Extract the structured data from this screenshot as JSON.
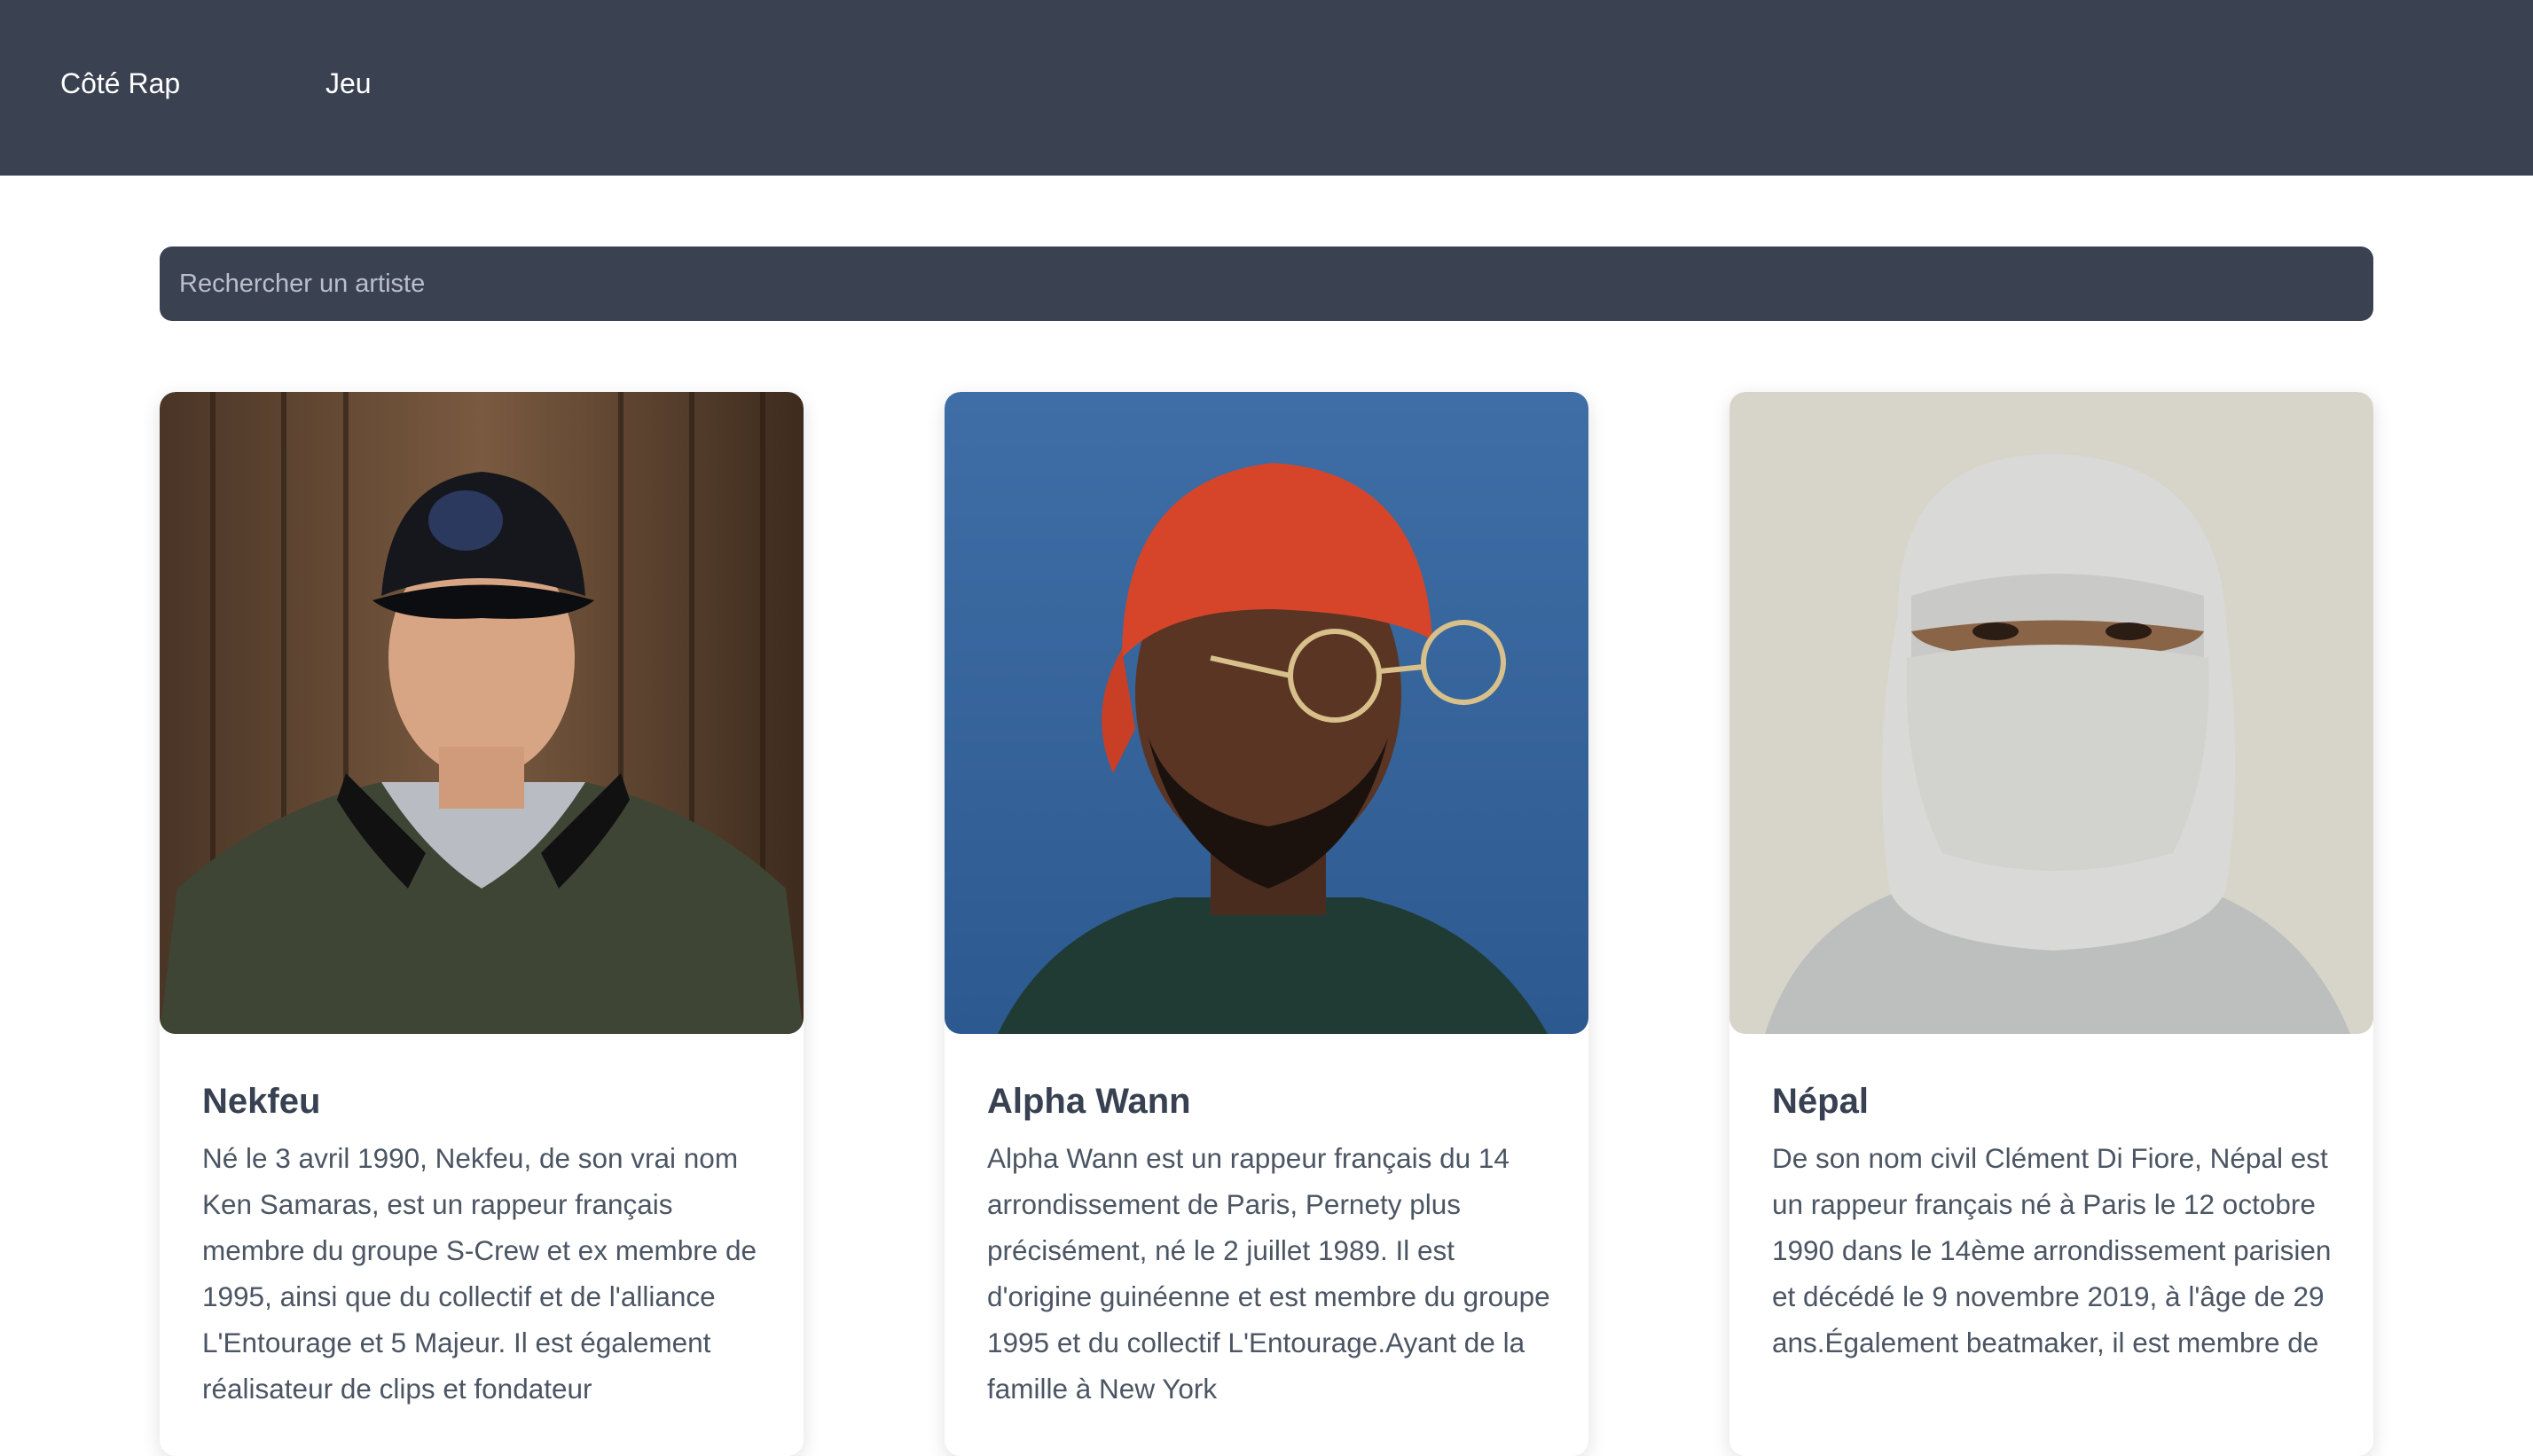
{
  "nav": {
    "brand": "Côté Rap",
    "game": "Jeu"
  },
  "search": {
    "placeholder": "Rechercher un artiste"
  },
  "artists": [
    {
      "name": "Nekfeu",
      "bio": "Né le 3 avril 1990, Nekfeu, de son vrai nom Ken Samaras, est un rappeur français membre du groupe S-Crew et ex membre de 1995, ainsi que du collectif et de l'alliance L'Entourage et 5 Majeur. Il est également réalisateur de clips et fondateur"
    },
    {
      "name": "Alpha Wann",
      "bio": "Alpha Wann est un rappeur français du 14 arrondissement de Paris, Pernety plus précisément, né le 2 juillet 1989. Il est d'origine guinéenne et est membre du groupe 1995 et du collectif L'Entourage.Ayant de la famille à New York"
    },
    {
      "name": "Népal",
      "bio": "De son nom civil Clément Di Fiore, Népal est un rappeur français né à Paris le 12 octobre 1990 dans le 14ème arrondissement parisien et décédé le 9 novembre 2019, à l'âge de 29 ans.Également beatmaker, il est membre de"
    }
  ],
  "colors": {
    "navbar": "#3a4151",
    "search_bg": "#3a4151",
    "title": "#374151",
    "text": "#4b5563"
  }
}
